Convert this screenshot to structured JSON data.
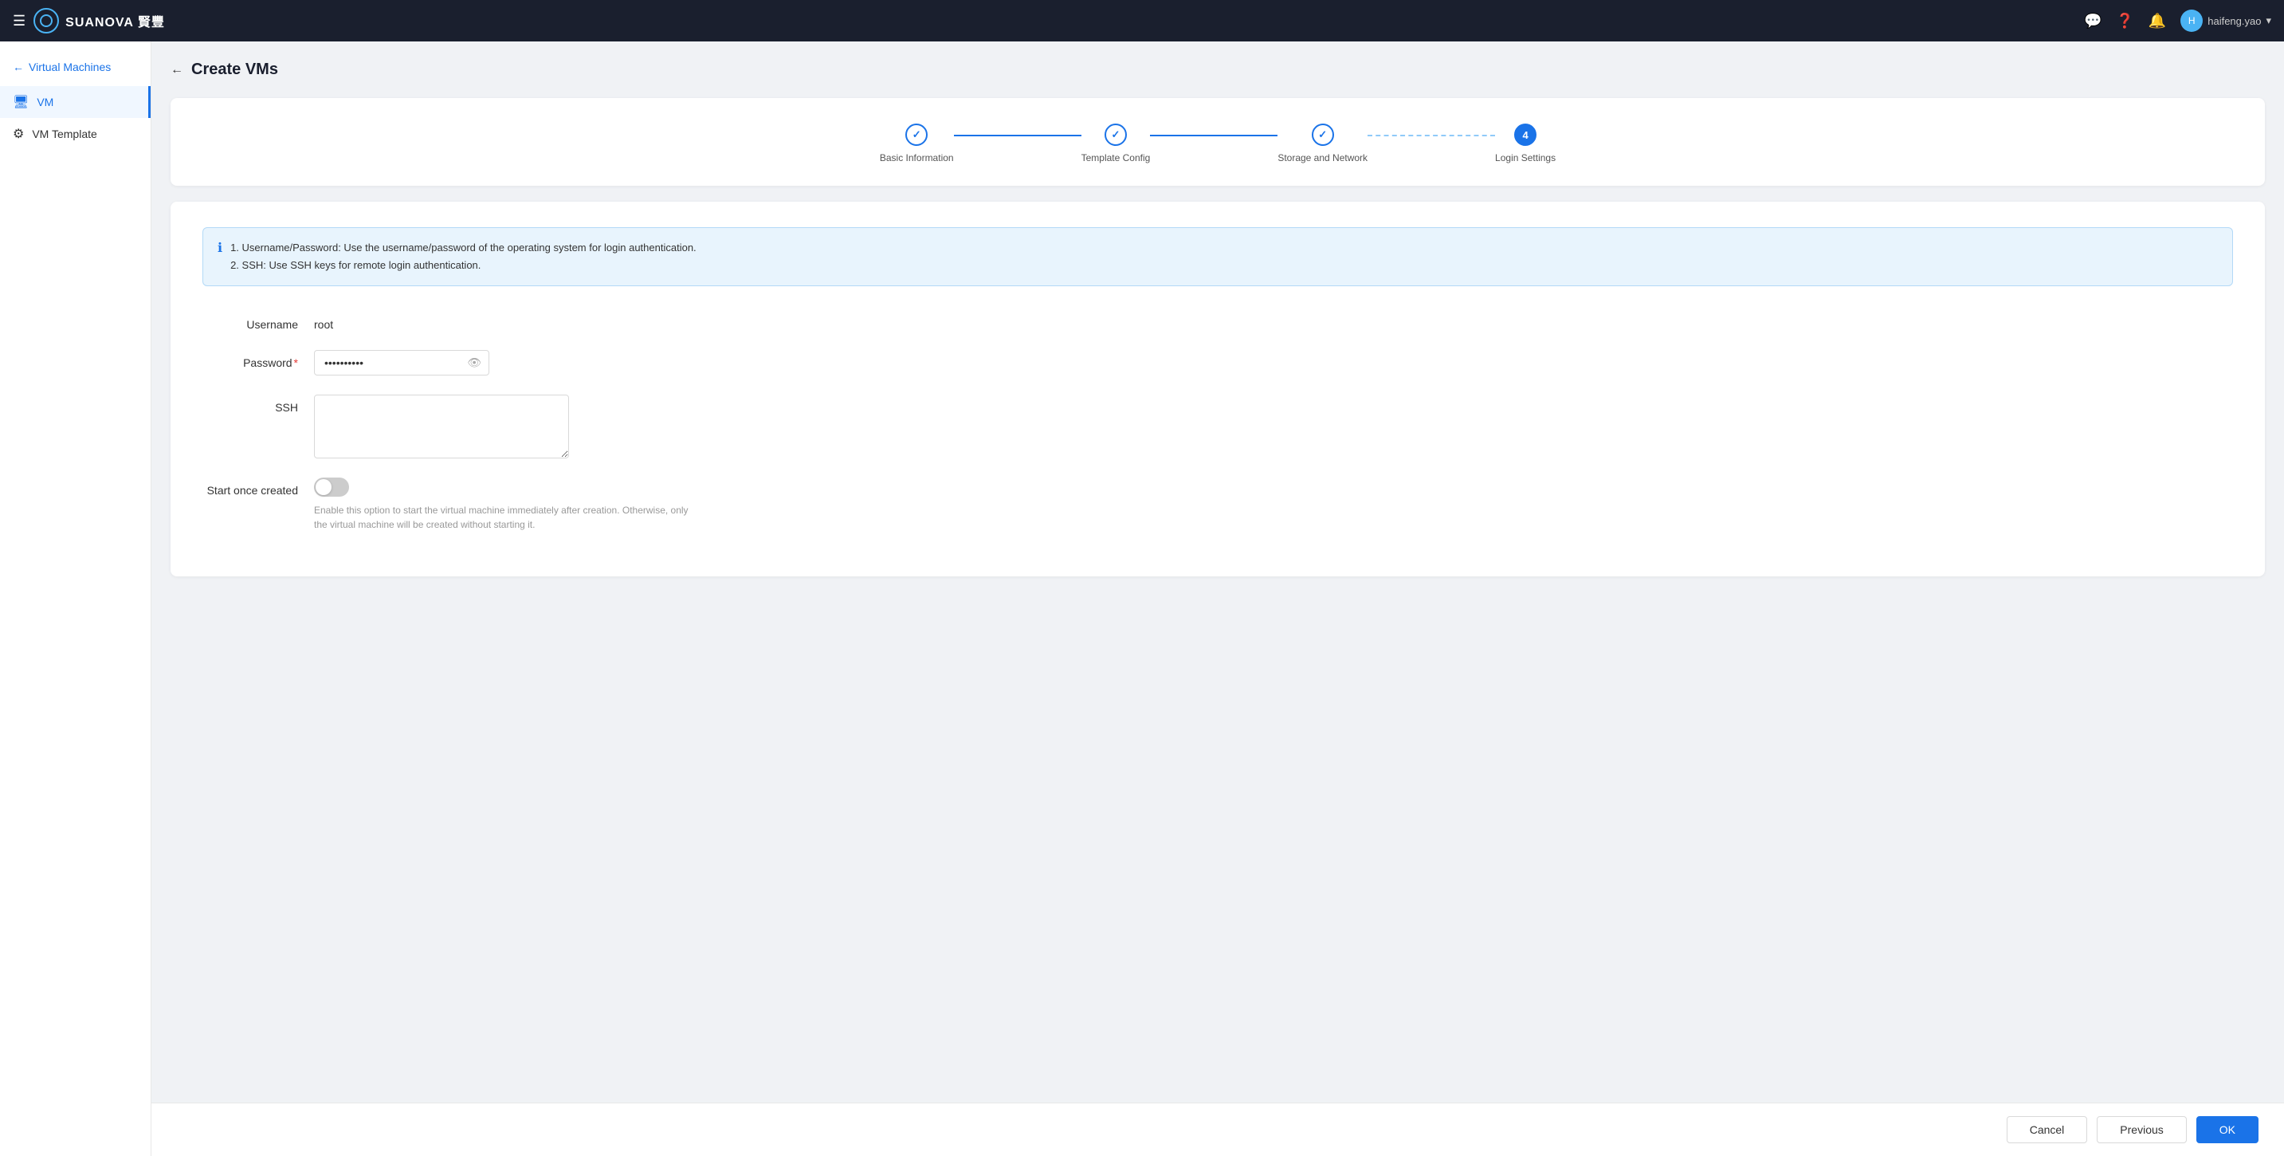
{
  "brand": {
    "name": "SUANOVA 賢豐"
  },
  "topnav": {
    "user": "haifeng.yao",
    "icons": [
      "comment-icon",
      "help-icon",
      "bell-icon"
    ]
  },
  "sidebar": {
    "back_label": "Virtual Machines",
    "items": [
      {
        "id": "vm",
        "label": "VM",
        "active": true
      },
      {
        "id": "vm-template",
        "label": "VM Template",
        "active": false
      }
    ]
  },
  "page": {
    "title": "Create VMs"
  },
  "steps": [
    {
      "id": "basic-info",
      "label": "Basic Information",
      "state": "done",
      "number": "✓"
    },
    {
      "id": "template-config",
      "label": "Template Config",
      "state": "done",
      "number": "✓"
    },
    {
      "id": "storage-network",
      "label": "Storage and Network",
      "state": "done",
      "number": "✓"
    },
    {
      "id": "login-settings",
      "label": "Login Settings",
      "state": "active",
      "number": "4"
    }
  ],
  "info_banner": {
    "line1": "1. Username/Password: Use the username/password of the operating system for login authentication.",
    "line2": "2. SSH: Use SSH keys for remote login authentication."
  },
  "form": {
    "username_label": "Username",
    "username_value": "root",
    "password_label": "Password",
    "password_value": "••••••••••",
    "password_required": "*",
    "ssh_label": "SSH",
    "ssh_value": "",
    "start_once_label": "Start once created",
    "start_once_hint": "Enable this option to start the virtual machine immediately after creation. Otherwise, only the virtual machine will be created without starting it."
  },
  "footer": {
    "cancel_label": "Cancel",
    "previous_label": "Previous",
    "ok_label": "OK"
  }
}
